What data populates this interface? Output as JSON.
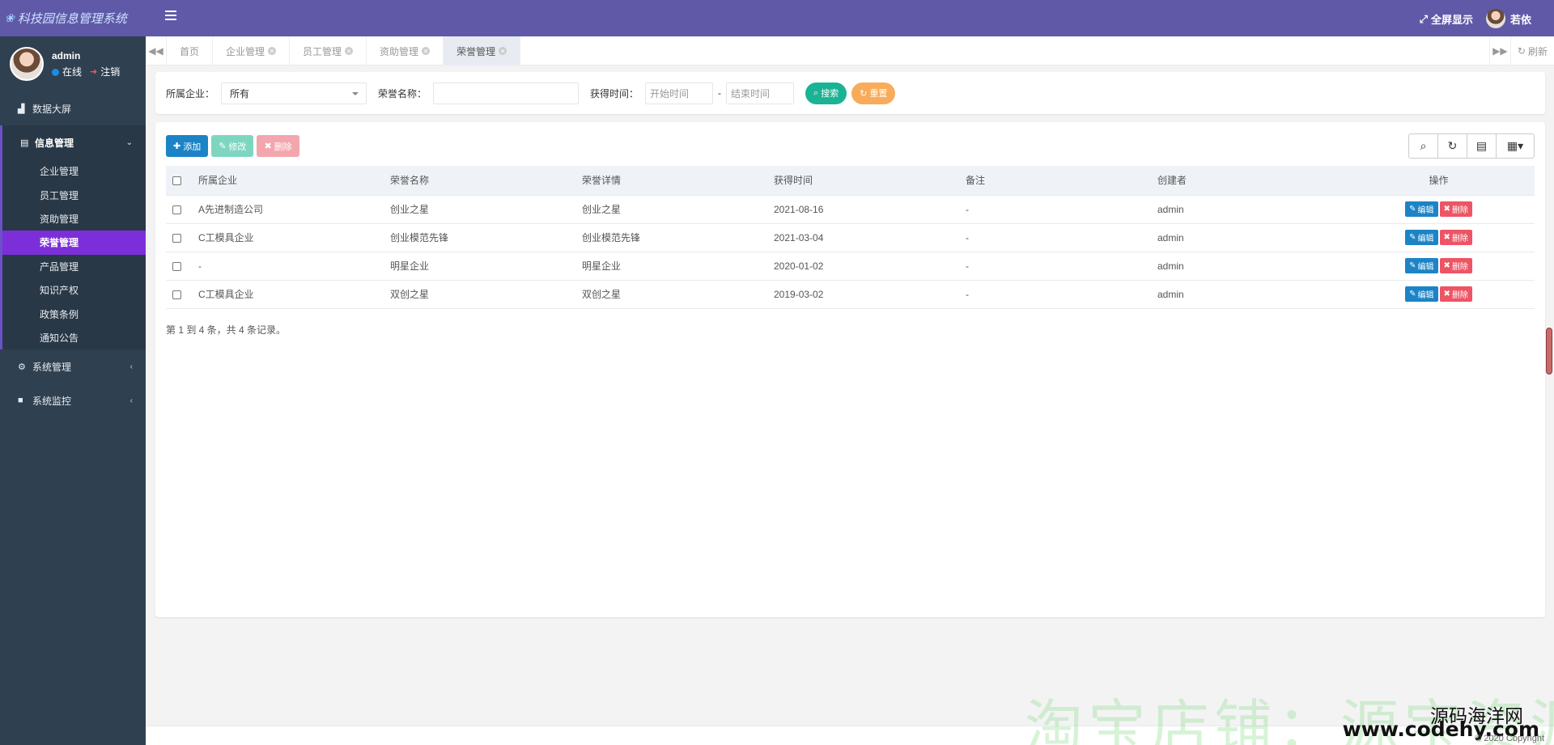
{
  "app": {
    "title": "科技园信息管理系统"
  },
  "user": {
    "name": "admin",
    "status": "在线",
    "logout": "注销"
  },
  "sidebar": {
    "items": [
      {
        "label": "数据大屏",
        "icon": "area-chart-icon"
      }
    ],
    "group": {
      "label": "信息管理",
      "items": [
        "企业管理",
        "员工管理",
        "资助管理",
        "荣誉管理",
        "产品管理",
        "知识产权",
        "政策条例",
        "通知公告"
      ],
      "active": "荣誉管理"
    },
    "bottom": [
      {
        "label": "系统管理",
        "icon": "gear-icon"
      },
      {
        "label": "系统监控",
        "icon": "video-camera-icon"
      }
    ]
  },
  "header": {
    "fullscreen": "全屏显示",
    "username": "若依"
  },
  "tabs": [
    {
      "label": "首页",
      "closable": false
    },
    {
      "label": "企业管理",
      "closable": true
    },
    {
      "label": "员工管理",
      "closable": true
    },
    {
      "label": "资助管理",
      "closable": true
    },
    {
      "label": "荣誉管理",
      "closable": true,
      "active": true
    }
  ],
  "tabs_refresh": "刷新",
  "search": {
    "company_label": "所属企业：",
    "company_value": "所有",
    "name_label": "荣誉名称：",
    "name_value": "",
    "time_label": "获得时间：",
    "start_placeholder": "开始时间",
    "end_placeholder": "结束时间",
    "dash": "-",
    "search_btn": "搜索",
    "reset_btn": "重置"
  },
  "toolbar": {
    "add": "添加",
    "edit": "修改",
    "delete": "删除"
  },
  "table": {
    "headers": [
      "所属企业",
      "荣誉名称",
      "荣誉详情",
      "获得时间",
      "备注",
      "创建者",
      "操作"
    ],
    "rows": [
      [
        "A先进制造公司",
        "创业之星",
        "创业之星",
        "2021-08-16",
        "-",
        "admin"
      ],
      [
        "C工模具企业",
        "创业模范先锋",
        "创业模范先锋",
        "2021-03-04",
        "-",
        "admin"
      ],
      [
        "-",
        "明星企业",
        "明星企业",
        "2020-01-02",
        "-",
        "admin"
      ],
      [
        "C工模具企业",
        "双创之星",
        "双创之星",
        "2019-03-02",
        "-",
        "admin"
      ]
    ],
    "row_edit": "编辑",
    "row_delete": "删除"
  },
  "pager": "第 1 到 4 条，共 4 条记录。",
  "watermark": {
    "shop": "淘宝店铺：源宝资源",
    "site_name": "源码海洋网",
    "site_url": "www.codehy.com"
  },
  "copyright": "© 2020 Copyright",
  "colors": {
    "header": "#6059a8",
    "sidebar": "#2f4050",
    "active_menu": "#7c2fd9",
    "primary": "#1c84c6",
    "success": "#1ab394",
    "warning": "#f8ac59",
    "danger": "#ed5565"
  }
}
